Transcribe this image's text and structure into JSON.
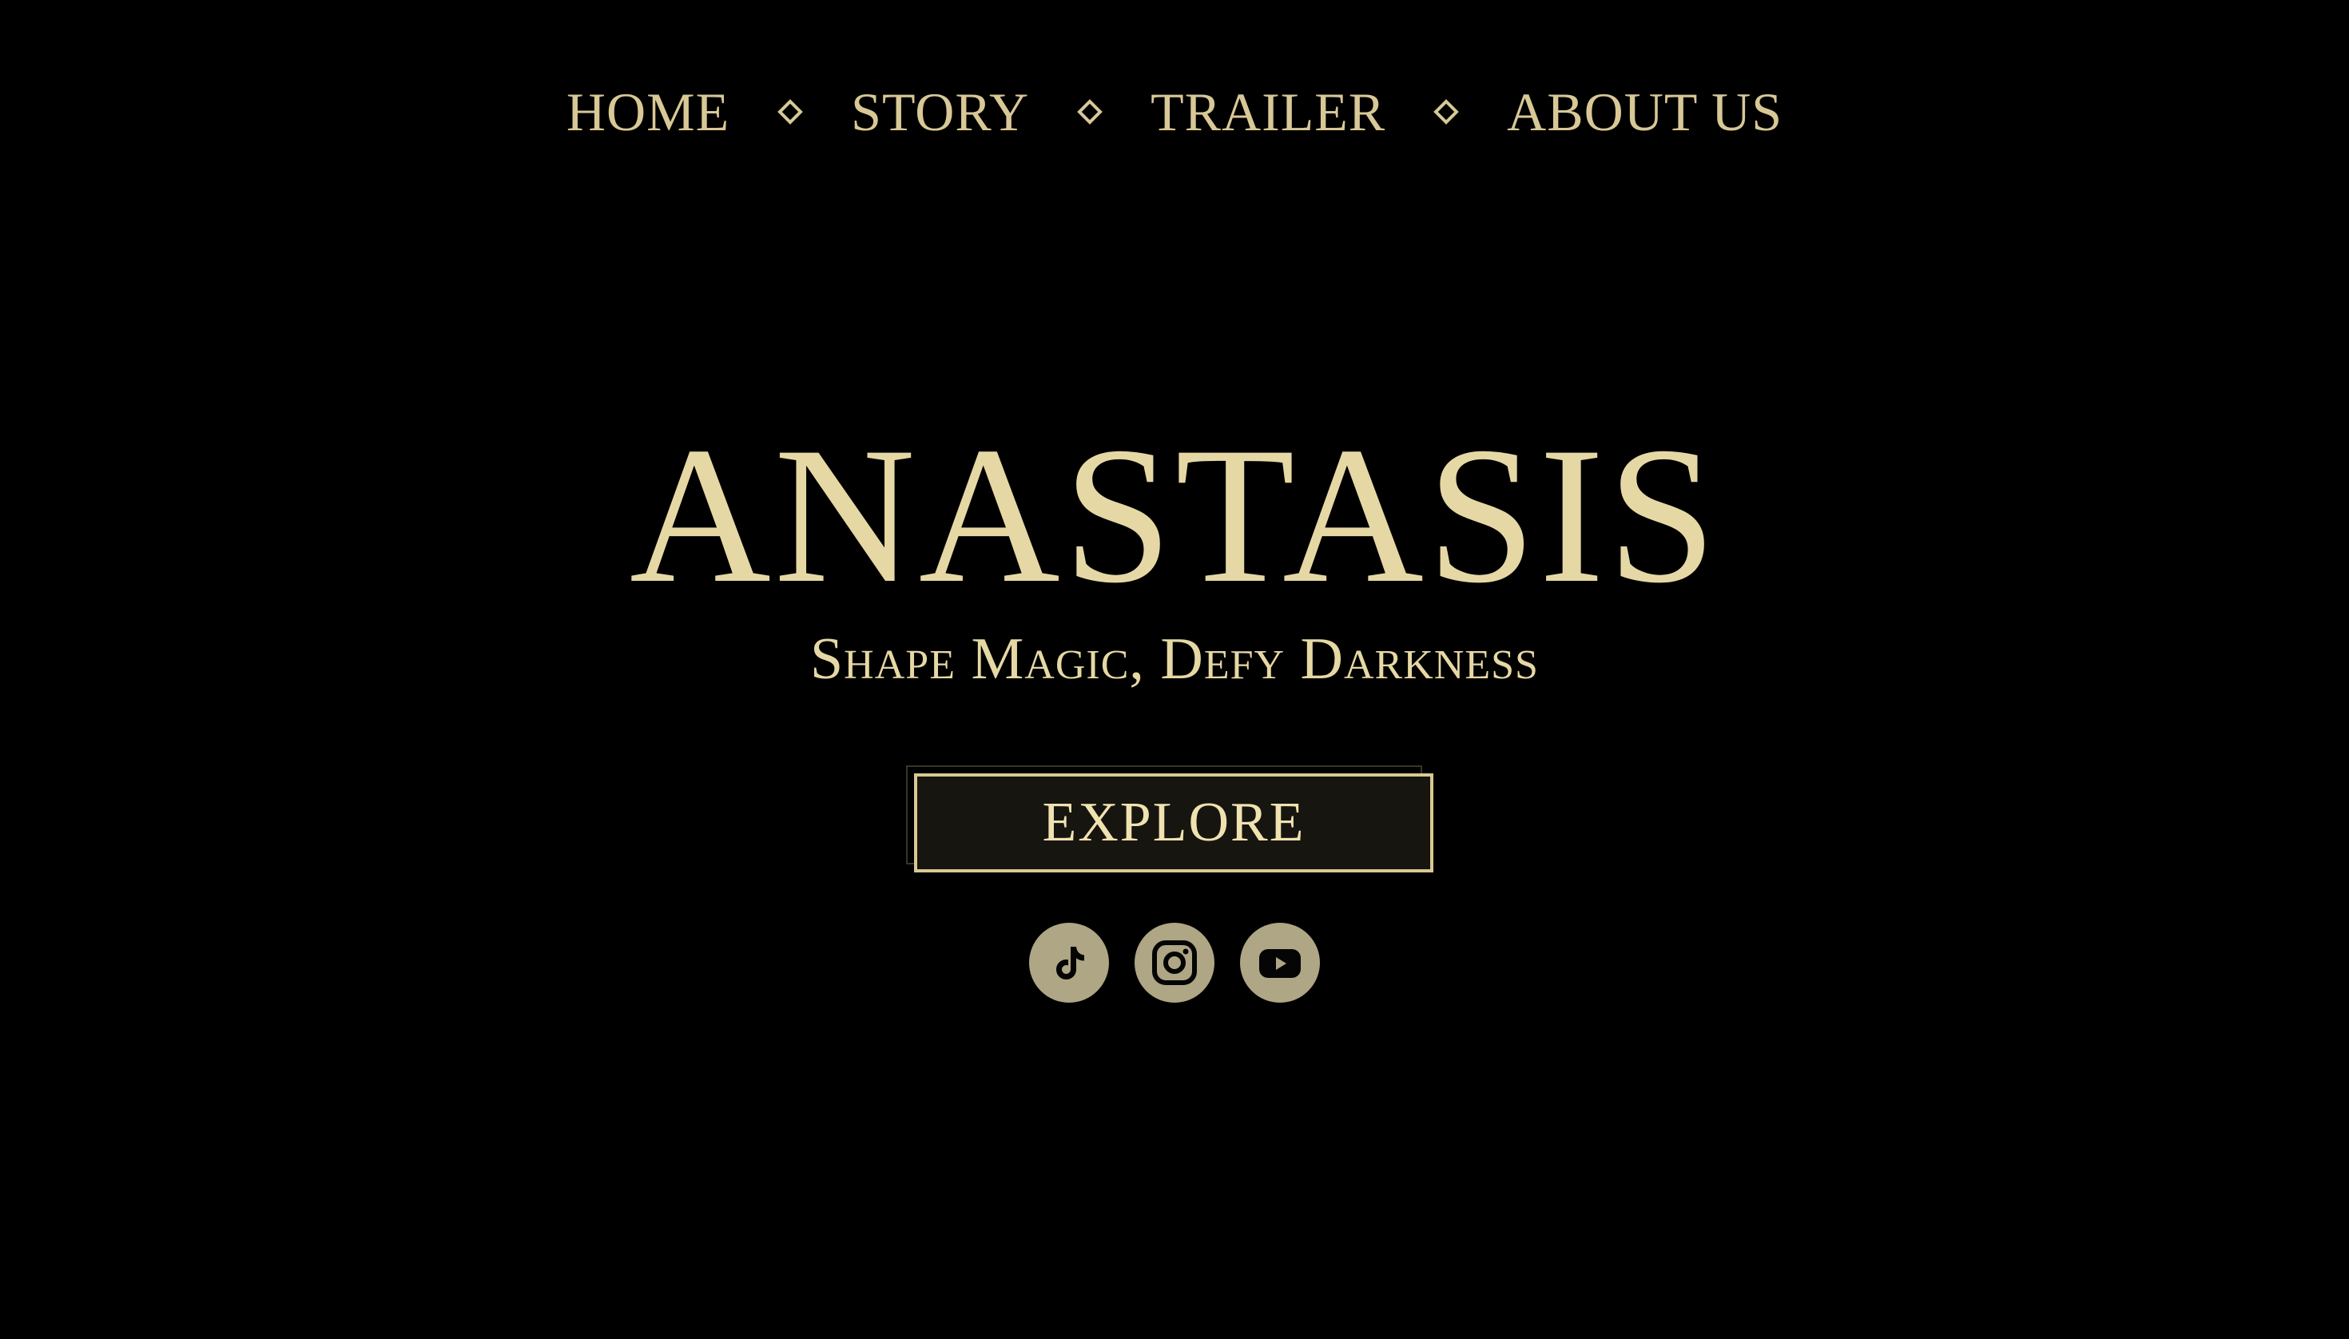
{
  "nav": {
    "items": [
      {
        "label": "HOME"
      },
      {
        "label": "STORY"
      },
      {
        "label": "TRAILER"
      },
      {
        "label": "ABOUT US"
      }
    ],
    "separator_icon": "diamond-outline"
  },
  "hero": {
    "title": "ANASTASIS",
    "tagline": "Shape Magic, Defy Darkness"
  },
  "cta": {
    "label": "EXPLORE"
  },
  "social": {
    "items": [
      {
        "icon": "tiktok-icon"
      },
      {
        "icon": "instagram-icon"
      },
      {
        "icon": "youtube-icon"
      }
    ]
  },
  "colors": {
    "background": "#000000",
    "gold": "#e6d8a4",
    "nav_gold": "#d8c896",
    "social_bg": "#aea684"
  }
}
